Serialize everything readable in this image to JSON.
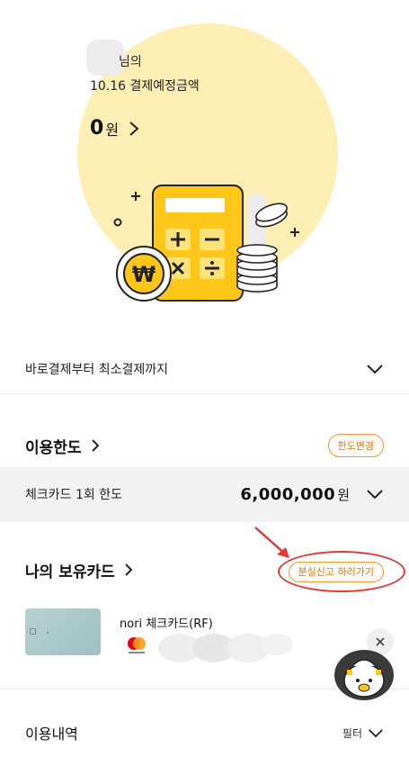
{
  "hero": {
    "owner_suffix": "님의",
    "due_label": "10.16 결제예정금액",
    "amount": "0",
    "amount_unit": "원"
  },
  "payment_range": {
    "label": "바로결제부터 최소결제까지"
  },
  "limit": {
    "title": "이용한도",
    "change_button": "한도변경",
    "row_label": "체크카드 1회 한도",
    "value": "6,000,000",
    "unit": "원"
  },
  "cards": {
    "title": "나의 보유카드",
    "report_button": "분실신고 하러가기",
    "items": [
      {
        "name": "nori 체크카드(RF)",
        "network": "mastercard"
      }
    ]
  },
  "history": {
    "title": "이용내역",
    "filter": "필터"
  },
  "colors": {
    "hero_bg": "#fdefb4",
    "calculator": "#ffc61a",
    "accent_orange": "#e07a10",
    "annotation_red": "#e53935"
  }
}
